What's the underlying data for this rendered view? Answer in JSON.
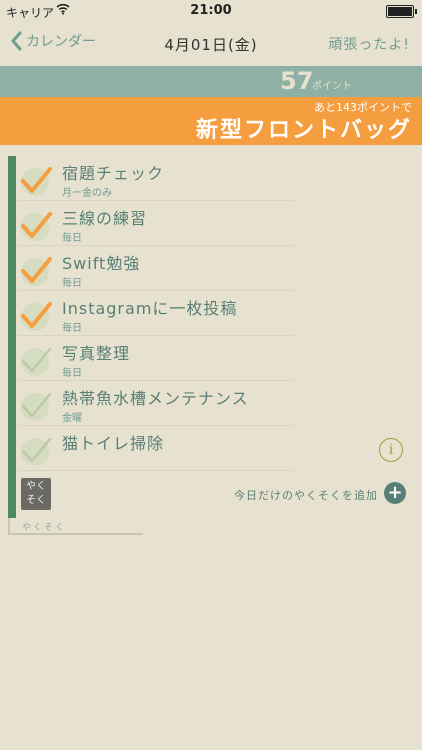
{
  "status_bar": {
    "carrier": "キャリア",
    "time": "21:00"
  },
  "nav": {
    "back_label": "カレンダー",
    "title": "4月01日(金)",
    "right_label": "頑張ったよ!"
  },
  "points": {
    "value": "57",
    "unit": "ポイント"
  },
  "goal": {
    "remaining_text": "あと143ポイントで",
    "name": "新型フロントバッグ"
  },
  "tasks": [
    {
      "title": "宿題チェック",
      "subtitle": "月ー金のみ",
      "done": true
    },
    {
      "title": "三線の練習",
      "subtitle": "毎日",
      "done": true
    },
    {
      "title": "Swift勉強",
      "subtitle": "毎日",
      "done": true
    },
    {
      "title": "Instagramに一枚投稿",
      "subtitle": "毎日",
      "done": true
    },
    {
      "title": "写真整理",
      "subtitle": "毎日",
      "done": false
    },
    {
      "title": "熱帯魚水槽メンテナンス",
      "subtitle": "金曜",
      "done": false
    },
    {
      "title": "猫トイレ掃除",
      "subtitle": "",
      "done": false
    }
  ],
  "stamp": {
    "line1": "やく",
    "line2": "そく"
  },
  "add_today": {
    "label": "今日だけのやくそくを追加"
  },
  "frame_label": "やくそく",
  "colors": {
    "accent": "#f59e3f",
    "points_bar": "#8fb0a4",
    "list_bar": "#4e8a60",
    "background": "#e6e2cf"
  }
}
